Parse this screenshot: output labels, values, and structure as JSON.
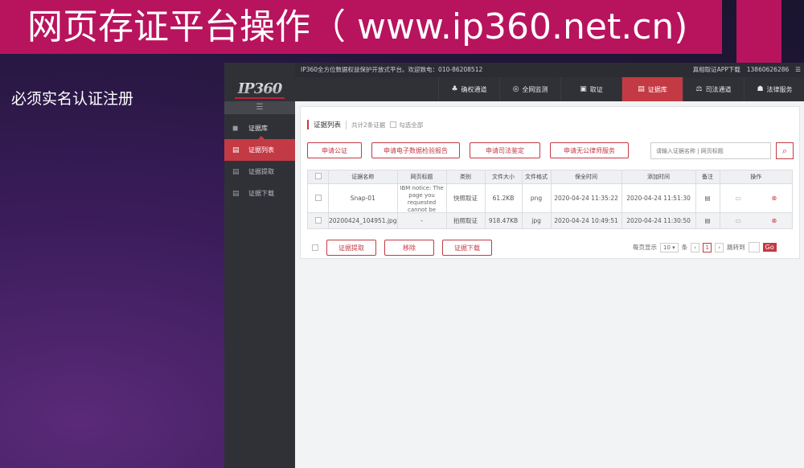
{
  "slide": {
    "title": "网页存证平台操作（ www.ip360.net.cn)",
    "subtitle": "必须实名认证注册"
  },
  "app": {
    "topbar": {
      "tagline": "IP360全方位数据权益保护开放式平台。欢迎致电：010-86208512",
      "app_download": "真相取证APP下载",
      "phone": "13860626286",
      "menu_icon": "☰"
    },
    "logo": "IP360",
    "nav": [
      {
        "label": "确权通道",
        "icon": "♣"
      },
      {
        "label": "全网监测",
        "icon": "◎"
      },
      {
        "label": "取证",
        "icon": "▣"
      },
      {
        "label": "证据库",
        "icon": "▤",
        "active": true
      },
      {
        "label": "司法通道",
        "icon": "⚖"
      },
      {
        "label": "法律服务",
        "icon": "☗"
      }
    ],
    "sidebar": {
      "toggle": "☰",
      "items": [
        {
          "label": "证据库",
          "icon": "◼"
        },
        {
          "label": "证据列表",
          "icon": "▤"
        },
        {
          "label": "证据提取",
          "icon": "▤"
        },
        {
          "label": "证据下载",
          "icon": "▤"
        }
      ]
    },
    "panel": {
      "title": "证据列表",
      "count": "共计2条证据",
      "select_all": "勾选全部",
      "buttons": [
        "申请公证",
        "申请电子数据检验报告",
        "申请司法鉴定",
        "申请无公律师服务"
      ],
      "search_placeholder": "请输入证据名称 | 网页标题",
      "search_icon": "⌕",
      "columns": [
        "证据名称",
        "网页标题",
        "类别",
        "文件大小",
        "文件格式",
        "保全时间",
        "添加时间",
        "备注",
        "操作"
      ],
      "rows": [
        {
          "name": "Snap-01",
          "page_title": "IBM notice: The page you requested cannot be displayed",
          "category": "快照取证",
          "size": "61.2KB",
          "format": "png",
          "saved": "2020-04-24 11:35:22",
          "added": "2020-04-24 11:51:30"
        },
        {
          "name": "20200424_104951.jpg",
          "page_title": "-",
          "category": "拍照取证",
          "size": "918.47KB",
          "format": "jpg",
          "saved": "2020-04-24 10:49:51",
          "added": "2020-04-24 11:30:50"
        }
      ],
      "footer_buttons": [
        "证据提取",
        "移除",
        "证据下载"
      ],
      "pager": {
        "per_page_label": "每页显示",
        "per_page": "10",
        "unit": "条",
        "current": "1",
        "jump_label": "跳转到",
        "go": "Go"
      }
    },
    "float_icon": "↻"
  }
}
